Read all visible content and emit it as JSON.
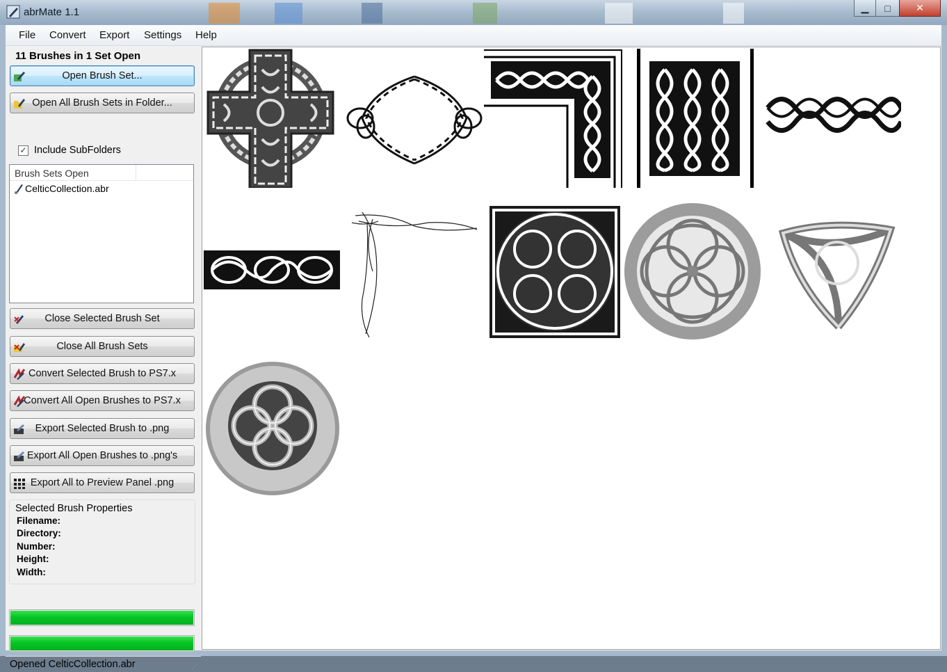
{
  "window": {
    "title": "abrMate 1.1",
    "minimize_glyph": "▁",
    "maximize_glyph": "□",
    "close_glyph": "✕"
  },
  "menu": [
    "File",
    "Convert",
    "Export",
    "Settings",
    "Help"
  ],
  "left_panel": {
    "set_count": "11 Brushes in 1 Set Open",
    "buttons": {
      "open_brush_set": "Open Brush Set...",
      "open_all_in_folder": "Open All Brush Sets in Folder...",
      "close_selected": "Close Selected Brush Set",
      "close_all": "Close All Brush Sets",
      "convert_selected": "Convert Selected Brush to PS7.x",
      "convert_all": "Convert All Open Brushes to PS7.x",
      "export_selected_png": "Export Selected Brush to .png",
      "export_all_png": "Export All Open Brushes to .png's",
      "export_preview_panel": "Export All to Preview Panel .png"
    },
    "include_subfolders": {
      "label": "Include SubFolders",
      "checked": true,
      "mark": "✓"
    },
    "brush_sets_list": {
      "header": "Brush Sets Open",
      "items": [
        "CelticCollection.abr"
      ]
    },
    "properties": {
      "title": "Selected Brush Properties",
      "filename_label": "Filename:",
      "directory_label": "Directory:",
      "number_label": "Number:",
      "height_label": "Height:",
      "width_label": "Width:"
    },
    "progress_bars": [
      1.0,
      1.0
    ],
    "status_text": "Opened CelticCollection.abr"
  },
  "preview": {
    "brush_count": 11,
    "brushes": [
      "celtic-cross",
      "knot-ring-frame",
      "corner-knot-border",
      "knot-panel",
      "knot-band-strip",
      "knot-strip-small",
      "corner-flourish",
      "square-knot-medallion",
      "stone-ring-medallion",
      "triquetra",
      "round-knot-shield"
    ]
  },
  "colors": {
    "accent_progress": "#06c526",
    "titlebar": "#a9bccf",
    "focus_button": "#bee6fd"
  }
}
